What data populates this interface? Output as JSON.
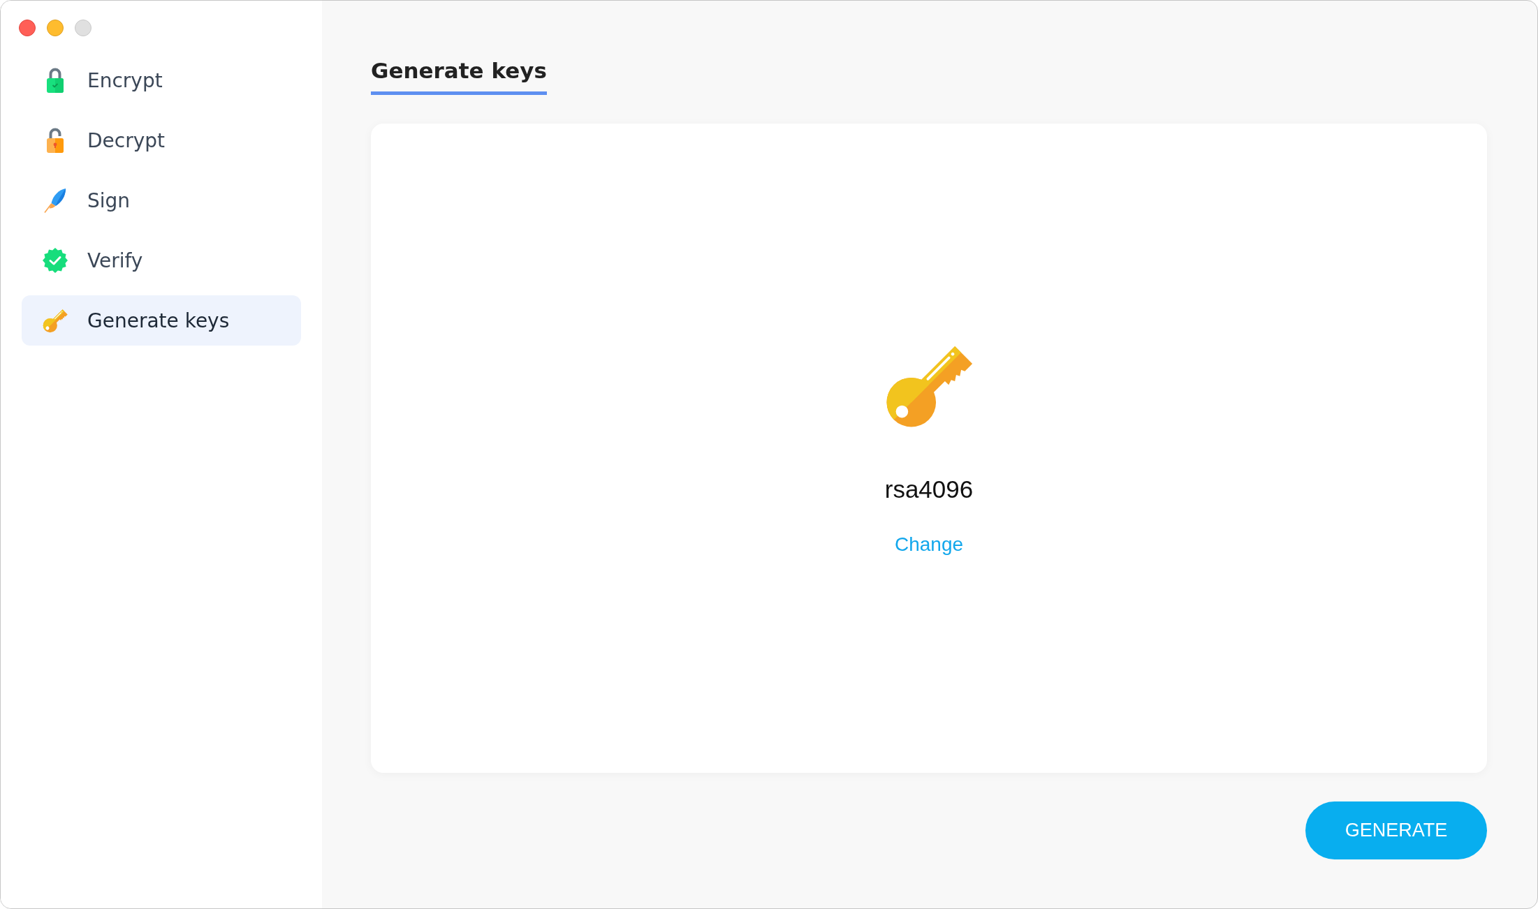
{
  "window_controls": [
    {
      "kind": "close",
      "disabled": false
    },
    {
      "kind": "minimize",
      "disabled": false
    },
    {
      "kind": "zoom",
      "disabled": true
    }
  ],
  "sidebar": {
    "items": [
      {
        "kind": "encrypt",
        "label": "Encrypt",
        "selected": false
      },
      {
        "kind": "decrypt",
        "label": "Decrypt",
        "selected": false
      },
      {
        "kind": "sign",
        "label": "Sign",
        "selected": false
      },
      {
        "kind": "verify",
        "label": "Verify",
        "selected": false
      },
      {
        "kind": "generate",
        "label": "Generate keys",
        "selected": true
      }
    ]
  },
  "page": {
    "title": "Generate keys",
    "key_type": "rsa4096",
    "change_link": "Change",
    "primary_button": "GENERATE"
  }
}
